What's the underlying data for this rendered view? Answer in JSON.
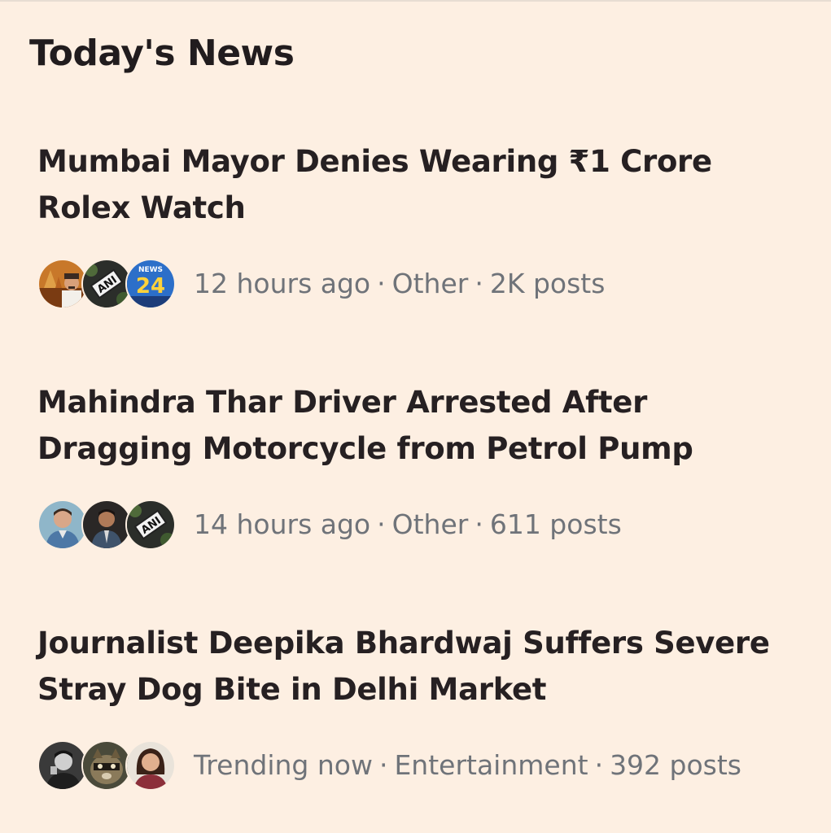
{
  "section": {
    "title": "Today's News"
  },
  "stories": [
    {
      "headline_line1": "Mumbai Mayor Denies Wearing ₹1 Crore",
      "headline_line2": "Rolex Watch",
      "time": "12 hours ago",
      "category": "Other",
      "posts": "2K posts",
      "avatars": [
        "temple-photo-avatar",
        "ani-logo-avatar",
        "news24-logo-avatar"
      ],
      "badge_texts": {
        "ani": "ANI",
        "news24_top": "NEWS",
        "news24_num": "24"
      }
    },
    {
      "headline_line1": "Mahindra Thar Driver Arrested After",
      "headline_line2": "Dragging Motorcycle from Petrol Pump",
      "time": "14 hours ago",
      "category": "Other",
      "posts": "611 posts",
      "avatars": [
        "man-photo-avatar",
        "man-suit-avatar",
        "ani-logo-avatar"
      ],
      "badge_texts": {
        "ani": "ANI"
      }
    },
    {
      "headline_line1": "Journalist Deepika Bhardwaj Suffers Severe",
      "headline_line2": "Stray Dog Bite in Delhi Market",
      "time": "Trending now",
      "category": "Entertainment",
      "posts": "392 posts",
      "avatars": [
        "man-bw-avatar",
        "raccoon-avatar",
        "woman-photo-avatar"
      ]
    }
  ],
  "separator": "·",
  "colors": {
    "background": "#fdefe2",
    "headline": "#262022",
    "meta": "#6f7379"
  }
}
